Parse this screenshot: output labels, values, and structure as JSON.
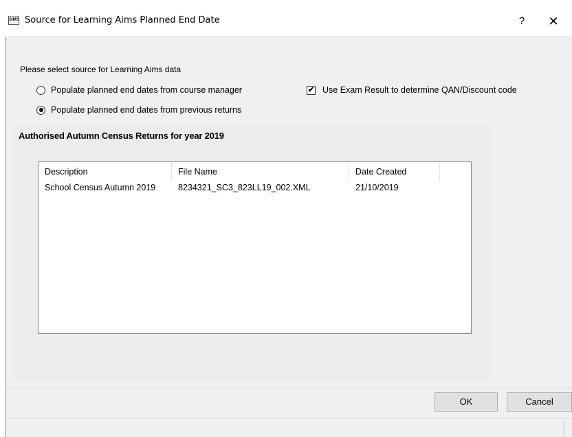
{
  "window": {
    "icon_text": "SIMS",
    "title": "Source for Learning Aims Planned End Date",
    "help": "?",
    "close": "✕"
  },
  "prompt": "Please select source for Learning Aims data",
  "options": {
    "course_manager": {
      "label": "Populate planned end dates from course manager",
      "checked": false
    },
    "previous_returns": {
      "label": "Populate planned end dates from previous returns",
      "checked": true
    },
    "exam_result": {
      "label": "Use Exam Result to determine QAN/Discount code",
      "checked": true,
      "mark": "✔"
    }
  },
  "group": {
    "title": "Authorised Autumn Census Returns for year 2019"
  },
  "list": {
    "columns": [
      "Description",
      "File Name",
      "Date Created"
    ],
    "rows": [
      [
        "School Census Autumn 2019",
        "8234321_SC3_823LL19_002.XML",
        "21/10/2019"
      ]
    ]
  },
  "buttons": {
    "ok": "OK",
    "cancel": "Cancel"
  }
}
